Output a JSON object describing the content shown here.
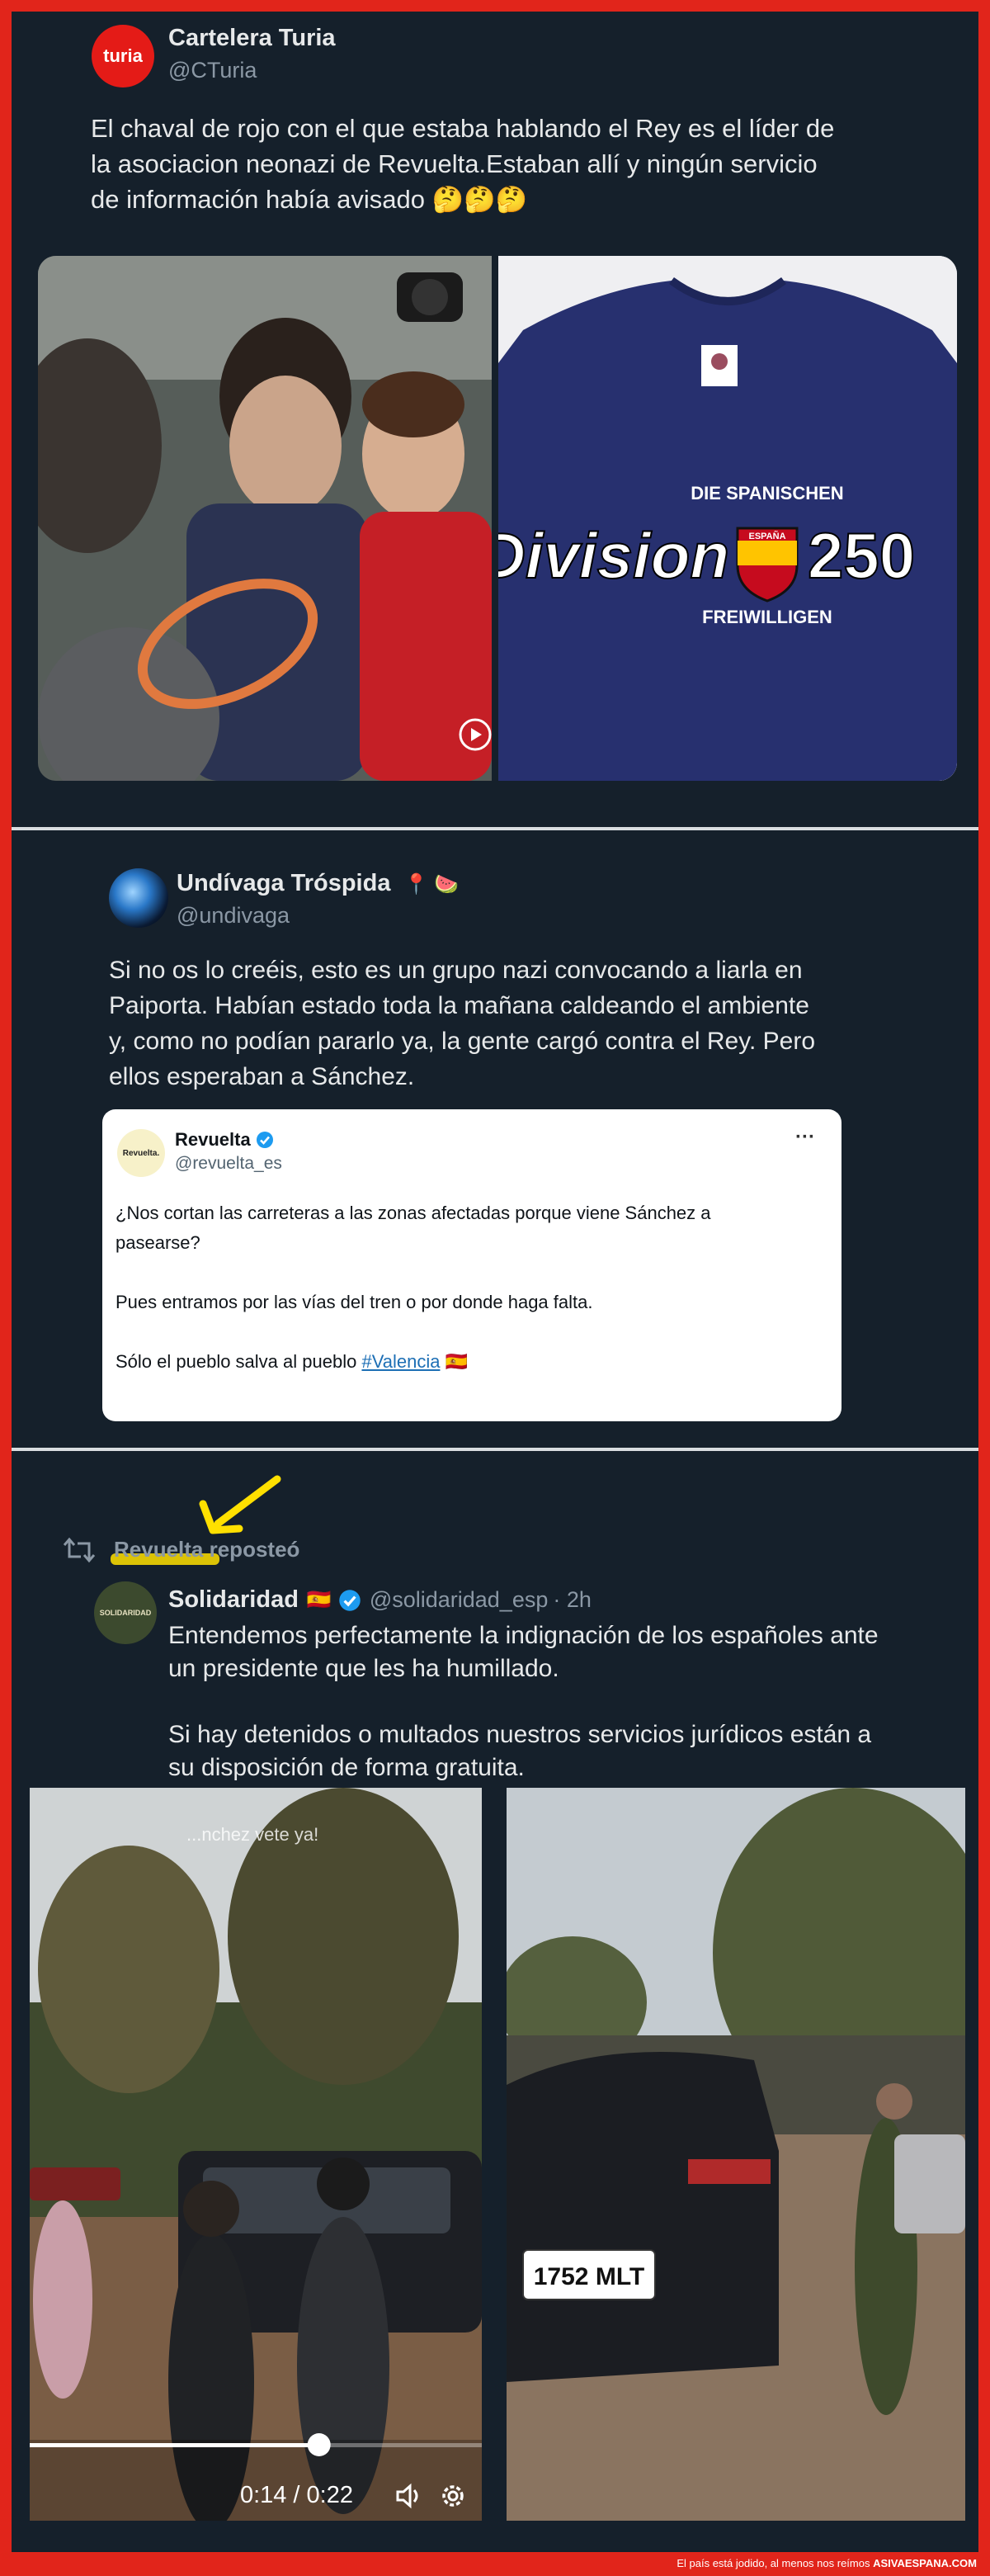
{
  "tweet1": {
    "avatar_text": "turia",
    "name": "Cartelera Turia",
    "handle": "@CTuria",
    "text_lines": [
      "El chaval de rojo con el que estaba hablando el Rey es el líder de",
      "la asociacion neonazi de Revuelta.Estaban allí y ningún servicio",
      "de información había avisado 🤔🤔🤔"
    ],
    "shirt": {
      "title_left": "Division",
      "title_right": "250",
      "arc_top": "DIE SPANISCHEN",
      "arc_bottom": "FREIWILLIGEN",
      "shield_label": "ESPAÑA"
    }
  },
  "tweet2": {
    "name": "Undívaga Tróspida",
    "name_emojis": "📍 🍉",
    "handle": "@undivaga",
    "text_lines": [
      "Si no os lo creéis, esto es un grupo nazi convocando a liarla en",
      "Paiporta. Habían estado toda la mañana caldeando el ambiente",
      "y, como no podían pararlo ya, la gente cargó contra el Rey. Pero",
      "ellos esperaban a Sánchez."
    ],
    "quoted": {
      "avatar_text": "Revuelta.",
      "name": "Revuelta",
      "handle": "@revuelta_es",
      "menu": "···",
      "para1_lines": [
        "¿Nos cortan las carreteras a las zonas afectadas porque viene Sánchez a",
        "pasearse?"
      ],
      "para2": "Pues entramos por las vías del tren o por donde haga falta.",
      "para3_prefix": "Sólo el pueblo salva al pueblo ",
      "para3_hashtag": "#Valencia",
      "para3_flag": "🇪🇸"
    }
  },
  "tweet3": {
    "repost_label": "Revuelta reposteó",
    "avatar_text": "SOLIDARIDAD",
    "name": "Solidaridad",
    "flag": "🇪🇸",
    "handle": "@solidaridad_esp",
    "time": "· 2h",
    "para1_lines": [
      "Entendemos perfectamente la indignación de los españoles ante",
      "un presidente que les ha humillado."
    ],
    "para2_lines": [
      "Si hay detenidos o multados nuestros servicios jurídicos están a",
      "su disposición de forma gratuita."
    ],
    "video": {
      "caption": "...nchez vete ya!",
      "time_readout": "0:14 / 0:22",
      "progress": 0.64,
      "plate": "1752 MLT"
    }
  },
  "footer": {
    "prefix": "El país está jodido, al menos nos reímos ",
    "brand": "ASIVAESPANA.COM"
  },
  "colors": {
    "frame_red": "#e1251b",
    "background": "#15202b",
    "link_blue": "#1d9bf0",
    "verified": "#1d9bf0",
    "highlight_yellow": "#ffe000"
  },
  "icons": [
    "retweet-icon",
    "verified-badge-icon",
    "more-icon",
    "play-icon",
    "volume-icon",
    "settings-icon",
    "arrow-annotation-icon"
  ]
}
